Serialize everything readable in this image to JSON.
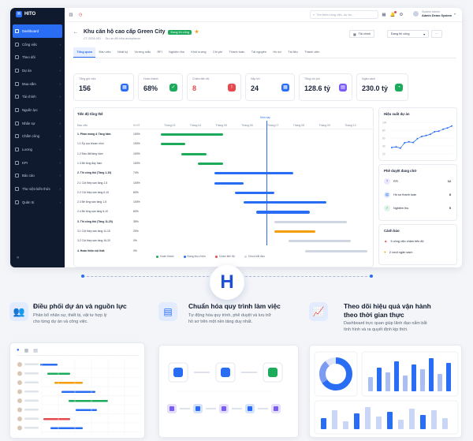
{
  "app": {
    "name": "HITO"
  },
  "sidebar": {
    "items": [
      {
        "label": "Dashboard",
        "active": true
      },
      {
        "label": "Công việc"
      },
      {
        "label": "Theo dõi"
      },
      {
        "label": "Dự án"
      },
      {
        "label": "Mua sắm"
      },
      {
        "label": "Tài chính"
      },
      {
        "label": "Nguồn lực"
      },
      {
        "label": "Nhân sự"
      },
      {
        "label": "Chấm công"
      },
      {
        "label": "Lương"
      },
      {
        "label": "KPI"
      },
      {
        "label": "Báo cáo"
      },
      {
        "label": "Thư viện kiến thức"
      },
      {
        "label": "Quản trị"
      }
    ],
    "collapse_icon": "«"
  },
  "topbar": {
    "search_placeholder": "Tìm kiếm công việc, dự án...",
    "user_role": "System Admin",
    "user_name": "Admin Demo System"
  },
  "project": {
    "back_icon": "←",
    "title": "Khu căn hộ cao cấp Green City",
    "status": "Đang thi công",
    "star_icon": "★",
    "code": "CT-2026-001",
    "meta": "Dự án đã thỏa acceptance",
    "btn_details": "Tải chính",
    "btn_status": "Đang thi công"
  },
  "tabs": [
    "Tổng quan",
    "Đầu việc",
    "Nhật ký",
    "Vướng mắc",
    "RFI",
    "Nghiệm thu",
    "Khối lượng",
    "Chi phí",
    "Thanh toán",
    "Tài nguyên",
    "Hồ sơ",
    "Tài liệu",
    "Thành viên"
  ],
  "kpis": [
    {
      "label": "Tổng giờ việc",
      "value": "156",
      "color": "#2a6df5",
      "icon": "▦"
    },
    {
      "label": "Hoàn thành",
      "value": "68%",
      "color": "#1bab5a",
      "icon": "✓"
    },
    {
      "label": "Chậm tiến độ",
      "value": "8",
      "color": "#e5484d",
      "icon": "!"
    },
    {
      "label": "Sắp tới",
      "value": "24",
      "color": "#2a6df5",
      "icon": "▦"
    },
    {
      "label": "Tổng chi phí",
      "value": "128.6 tỷ",
      "color": "#7b5cf5",
      "icon": "▤"
    },
    {
      "label": "Ngân sách",
      "value": "230.0 tỷ",
      "color": "#1bab5a",
      "icon": "◔"
    }
  ],
  "gantt": {
    "title": "Tiến độ tổng thể",
    "col_name": "Đầu việc",
    "col_pct": "% HT",
    "months": [
      "Tháng 03",
      "Tháng 04",
      "Tháng 05",
      "Tháng 06",
      "Tháng 07",
      "Tháng 08",
      "Tháng 09",
      "Tháng 10"
    ],
    "today_label": "Hôm nay",
    "rows": [
      {
        "name": "1. Phần móng & Tầng hầm",
        "pct": "100%",
        "group": true,
        "start": 0.0,
        "end": 0.3,
        "color": "#1bab5a"
      },
      {
        "name": "1.1 Ép cọc khoan nhồi",
        "pct": "100%",
        "start": 0.0,
        "end": 0.12,
        "color": "#1bab5a"
      },
      {
        "name": "1.2 Đào đất tầng hầm",
        "pct": "100%",
        "start": 0.1,
        "end": 0.22,
        "color": "#1bab5a"
      },
      {
        "name": "1.3 Bê tông đáy hầm",
        "pct": "100%",
        "start": 0.18,
        "end": 0.3,
        "color": "#1bab5a"
      },
      {
        "name": "2. Thi công thô (Tầng 1-10)",
        "pct": "74%",
        "group": true,
        "start": 0.26,
        "end": 0.64,
        "color": "#2a6df5"
      },
      {
        "name": "2.1 Cột thép sàn tầng 1-5",
        "pct": "100%",
        "start": 0.26,
        "end": 0.4,
        "color": "#2a6df5"
      },
      {
        "name": "2.2 Cột thép sàn tầng 6-10",
        "pct": "60%",
        "start": 0.36,
        "end": 0.55,
        "color": "#2a6df5"
      },
      {
        "name": "2.3 Bê tông sàn tầng 1-5",
        "pct": "100%",
        "start": 0.4,
        "end": 0.8,
        "color": "#2a6df5"
      },
      {
        "name": "2.4 Bê tông sàn tầng 6-10",
        "pct": "60%",
        "start": 0.46,
        "end": 0.72,
        "color": "#2a6df5"
      },
      {
        "name": "3. Thi công thô (Tầng 11-20)",
        "pct": "35%",
        "group": true,
        "start": 0.55,
        "end": 0.9,
        "color": "#cfd6e2"
      },
      {
        "name": "3.1 Cột thép sàn tầng 11-15",
        "pct": "20%",
        "start": 0.55,
        "end": 0.75,
        "color": "#f59e0b"
      },
      {
        "name": "3.2 Cột thép sàn tầng 16-20",
        "pct": "0%",
        "start": 0.62,
        "end": 0.92,
        "color": "#cfd6e2"
      },
      {
        "name": "4. Hoàn thiện nội thất",
        "pct": "0%",
        "group": true,
        "start": 0.7,
        "end": 1.0,
        "color": "#cfd6e2"
      }
    ],
    "legend": [
      {
        "label": "Hoàn thành",
        "color": "#1bab5a"
      },
      {
        "label": "Đang thực hiện",
        "color": "#2a6df5"
      },
      {
        "label": "Chậm tiến độ",
        "color": "#e5484d"
      },
      {
        "label": "Chưa bắt đầu",
        "color": "#cfd6e2"
      }
    ]
  },
  "performance": {
    "title": "Hiệu suất dự án",
    "y_ticks": [
      "100",
      "80",
      "60",
      "40",
      "20"
    ],
    "values": [
      20,
      22,
      18,
      35,
      38,
      36,
      48,
      55,
      58,
      62,
      70,
      72,
      78,
      82,
      88
    ]
  },
  "approvals": {
    "title": "Phê duyệt đang chờ",
    "items": [
      {
        "label": "RFI",
        "count": "12",
        "icon": "?"
      },
      {
        "label": "Hồ sơ thanh toán",
        "count": "8",
        "icon": "▤"
      },
      {
        "label": "Nghiệm thu",
        "count": "5",
        "icon": "✓"
      }
    ]
  },
  "alerts": {
    "title": "Cảnh báo",
    "items": [
      {
        "label": "5 công việc chậm tiến độ",
        "icon": "▲",
        "color": "#e5484d"
      },
      {
        "label": "2 vượt ngân sách",
        "icon": "●",
        "color": "#f2a515"
      }
    ]
  },
  "brand_mark": "H",
  "features": [
    {
      "title": "Điều phối dự án và nguồn lực",
      "desc": [
        "Phân bổ nhân sự, thiết bị, vật tư hợp lý",
        "cho từng dự án và công việc."
      ],
      "icon": "👥"
    },
    {
      "title": "Chuẩn hóa quy trình làm việc",
      "desc": [
        "Tự động hóa quy trình, phê duyệt và lưu trữ",
        "hồ sơ trên một nền tảng duy nhất."
      ],
      "icon": "▤"
    },
    {
      "title": "Theo dõi hiệu quả vận hành",
      "title2": "theo thời gian thực",
      "desc": [
        "Dashboard trực quan giúp lãnh đạo nắm bắt",
        "tình hình và ra quyết định kịp thời."
      ],
      "icon": "📈"
    }
  ]
}
